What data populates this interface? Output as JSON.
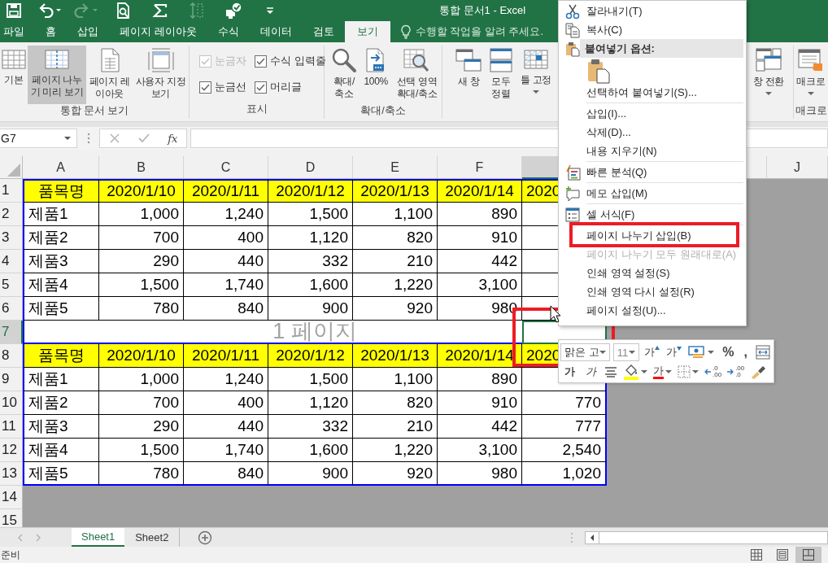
{
  "title_bar": {
    "title": "통합 문서1 - Excel",
    "quick_access": [
      {
        "kind": "save",
        "disabled": false
      },
      {
        "kind": "undo",
        "disabled": false
      },
      {
        "kind": "redo",
        "disabled": true
      },
      {
        "kind": "print_preview",
        "disabled": false
      },
      {
        "kind": "autosum",
        "disabled": false
      },
      {
        "kind": "spacing",
        "disabled": true
      },
      {
        "kind": "touch_mode",
        "disabled": false
      },
      {
        "kind": "customize",
        "disabled": false
      }
    ]
  },
  "ribbon_tabs": [
    {
      "label": "파일",
      "selected": false
    },
    {
      "label": "홈",
      "selected": false
    },
    {
      "label": "삽입",
      "selected": false
    },
    {
      "label": "페이지 레이아웃",
      "selected": false
    },
    {
      "label": "수식",
      "selected": false
    },
    {
      "label": "데이터",
      "selected": false
    },
    {
      "label": "검토",
      "selected": false
    },
    {
      "label": "보기",
      "selected": true
    }
  ],
  "tell_me": {
    "placeholder": "수행할 작업을 알려 주세요."
  },
  "ribbon_groups": [
    {
      "label": "통합 문서 보기",
      "kind": "buttons",
      "buttons": [
        {
          "kind": "normal_view",
          "label": "기본",
          "selected": false,
          "has_menu": false
        },
        {
          "kind": "page_break_preview",
          "label": "페이지 나누기 미리 보기",
          "selected": true,
          "has_menu": false
        },
        {
          "kind": "page_layout",
          "label": "페이지 레이아웃",
          "selected": false,
          "has_menu": false
        },
        {
          "kind": "custom_views",
          "label": "사용자 지정 보기",
          "selected": false,
          "has_menu": false
        }
      ]
    },
    {
      "label": "표시",
      "kind": "checkboxes",
      "checkboxes": [
        {
          "label": "눈금자",
          "checked": true,
          "disabled": true
        },
        {
          "label": "수식 입력줄",
          "checked": true,
          "disabled": false
        },
        {
          "label": "눈금선",
          "checked": true,
          "disabled": false
        },
        {
          "label": "머리글",
          "checked": true,
          "disabled": false
        }
      ]
    },
    {
      "label": "확대/축소",
      "kind": "buttons",
      "buttons": [
        {
          "kind": "zoom",
          "label": "확대/축소",
          "selected": false,
          "has_menu": false
        },
        {
          "kind": "zoom_100",
          "label": "100%",
          "selected": false,
          "has_menu": false
        },
        {
          "kind": "zoom_selection",
          "label": "선택 영역 확대/축소",
          "selected": false,
          "has_menu": false
        }
      ]
    },
    {
      "kind": "buttons",
      "buttons": [
        {
          "kind": "new_window",
          "label": "새 창",
          "selected": false,
          "has_menu": false
        },
        {
          "kind": "arrange_all",
          "label": "모두 정렬",
          "selected": false,
          "has_menu": false
        },
        {
          "kind": "freeze_panes",
          "label": "틀 고정",
          "selected": false,
          "has_menu": true
        },
        {
          "kind": "switch_windows",
          "label": "창 전환",
          "selected": false,
          "has_menu": true
        }
      ]
    },
    {
      "label": "매크로",
      "kind": "buttons",
      "buttons": [
        {
          "kind": "macros",
          "label": "매크로",
          "selected": false,
          "has_menu": true
        }
      ]
    }
  ],
  "formula_bar": {
    "name_box": "G7",
    "function_button": "fx"
  },
  "sheet": {
    "columns": [
      {
        "label": "A",
        "selected": false
      },
      {
        "label": "B",
        "selected": false
      },
      {
        "label": "C",
        "selected": false
      },
      {
        "label": "D",
        "selected": false
      },
      {
        "label": "E",
        "selected": false
      },
      {
        "label": "F",
        "selected": false
      },
      {
        "kind": "header",
        "selected": true
      },
      {
        "kind": "covered"
      },
      {
        "kind": "header",
        "selected": false
      },
      {
        "label": "J",
        "selected": false
      }
    ],
    "rows": [
      {
        "header": "1",
        "kind": "title",
        "selected": false,
        "cells": [
          "품목명",
          "2020/1/10",
          "2020/1/11",
          "2020/1/12",
          "2020/1/13",
          "2020/1/14",
          "2020"
        ]
      },
      {
        "header": "2",
        "kind": "data",
        "selected": false,
        "cells": [
          "제품1",
          "1,000",
          "1,240",
          "1,500",
          "1,100",
          "890"
        ]
      },
      {
        "header": "3",
        "kind": "data",
        "selected": false,
        "cells": [
          "제품2",
          "700",
          "400",
          "1,120",
          "820",
          "910"
        ]
      },
      {
        "header": "4",
        "kind": "data",
        "selected": false,
        "cells": [
          "제품3",
          "290",
          "440",
          "332",
          "210",
          "442"
        ]
      },
      {
        "header": "5",
        "kind": "data",
        "selected": false,
        "cells": [
          "제품4",
          "1,500",
          "1,740",
          "1,600",
          "1,220",
          "3,100"
        ]
      },
      {
        "header": "6",
        "kind": "data",
        "selected": false,
        "cells": [
          "제품5",
          "780",
          "840",
          "900",
          "920",
          "980"
        ]
      },
      {
        "header": "7",
        "kind": "blank",
        "selected": true,
        "page_label": "1 페이지"
      },
      {
        "header": "8",
        "kind": "title",
        "selected": false,
        "cells": [
          "품목명",
          "2020/1/10",
          "2020/1/11",
          "2020/1/12",
          "2020/1/13",
          "2020/1/14",
          "2020"
        ]
      },
      {
        "header": "9",
        "kind": "data",
        "selected": false,
        "cells": [
          "제품1",
          "1,000",
          "1,240",
          "1,500",
          "1,100",
          "890"
        ]
      },
      {
        "header": "10",
        "kind": "data",
        "selected": false,
        "cells": [
          "제품2",
          "700",
          "400",
          "1,120",
          "820",
          "910",
          "770"
        ]
      },
      {
        "header": "11",
        "kind": "data",
        "selected": false,
        "cells": [
          "제품3",
          "290",
          "440",
          "332",
          "210",
          "442",
          "777"
        ]
      },
      {
        "header": "12",
        "kind": "data",
        "selected": false,
        "cells": [
          "제품4",
          "1,500",
          "1,740",
          "1,600",
          "1,220",
          "3,100",
          "2,540"
        ]
      },
      {
        "header": "13",
        "kind": "data",
        "selected": false,
        "cells": [
          "제품5",
          "780",
          "840",
          "900",
          "920",
          "980",
          "1,020"
        ]
      },
      {
        "header": "14",
        "kind": "outside",
        "selected": false
      },
      {
        "header": "15",
        "kind": "outside",
        "selected": false
      }
    ],
    "active_cell_highlighted": true
  },
  "sheet_tabs": [
    {
      "label": "Sheet1",
      "selected": true
    },
    {
      "label": "Sheet2",
      "selected": false
    }
  ],
  "status_bar": {
    "text": "준비",
    "views": [
      {
        "kind": "normal",
        "selected": false
      },
      {
        "kind": "page_layout",
        "selected": false
      },
      {
        "kind": "page_break",
        "selected": true
      }
    ]
  },
  "context_menu": {
    "items": [
      {
        "kind": "cut",
        "label": "잘라내기(T)",
        "disabled": false,
        "highlighted": false
      },
      {
        "kind": "copy",
        "label": "복사(C)",
        "disabled": false,
        "highlighted": false
      },
      {
        "kind": "header",
        "label": "붙여넣기 옵션:"
      },
      {
        "kind": "paste_option"
      },
      {
        "kind": "command",
        "label": "선택하여 붙여넣기(S)...",
        "disabled": false,
        "highlighted": false
      },
      {
        "kind": "separator"
      },
      {
        "kind": "command",
        "label": "삽입(I)...",
        "disabled": false,
        "highlighted": false
      },
      {
        "kind": "command",
        "label": "삭제(D)...",
        "disabled": false,
        "highlighted": false
      },
      {
        "kind": "command",
        "label": "내용 지우기(N)",
        "disabled": false,
        "highlighted": false
      },
      {
        "kind": "separator"
      },
      {
        "kind": "quick_analysis",
        "label": "빠른 분석(Q)",
        "disabled": false,
        "highlighted": false
      },
      {
        "kind": "separator"
      },
      {
        "kind": "comment",
        "label": "메모 삽입(M)",
        "disabled": false,
        "highlighted": false
      },
      {
        "kind": "separator"
      },
      {
        "kind": "format_cells",
        "label": "셀 서식(F)",
        "disabled": false,
        "highlighted": false
      },
      {
        "kind": "separator"
      },
      {
        "kind": "command",
        "label": "페이지 나누기 삽입(B)",
        "disabled": false,
        "highlighted": true
      },
      {
        "kind": "command",
        "label": "페이지 나누기 모두 원래대로(A)",
        "disabled": true,
        "highlighted": false
      },
      {
        "kind": "command",
        "label": "인쇄 영역 설정(S)",
        "disabled": false,
        "highlighted": false
      },
      {
        "kind": "command",
        "label": "인쇄 영역 다시 설정(R)",
        "disabled": false,
        "highlighted": false
      },
      {
        "kind": "command",
        "label": "페이지 설정(U)...",
        "disabled": false,
        "highlighted": false
      }
    ]
  },
  "mini_toolbar": {
    "font_name": "맑은 고",
    "font_size": "11",
    "row_1": [
      {
        "kind": "grow_font",
        "label": "가"
      },
      {
        "kind": "shrink_font",
        "label": "가"
      },
      {
        "kind": "accounting"
      },
      {
        "kind": "text",
        "label": "%"
      },
      {
        "kind": "text",
        "label": ","
      },
      {
        "kind": "wrap"
      }
    ],
    "row_2": [
      {
        "kind": "bold",
        "label": "가"
      },
      {
        "kind": "italic",
        "label": "가"
      },
      {
        "kind": "align"
      },
      {
        "kind": "fill_color"
      },
      {
        "kind": "font_color",
        "label": "가"
      },
      {
        "kind": "borders"
      },
      {
        "kind": "increase_decimal",
        "upper": ".0",
        "lower": ".00"
      },
      {
        "kind": "decrease_decimal",
        "upper": ".00",
        "lower": ".0"
      },
      {
        "kind": "format_painter"
      }
    ]
  },
  "mouse_pointer": {
    "visible": true
  }
}
